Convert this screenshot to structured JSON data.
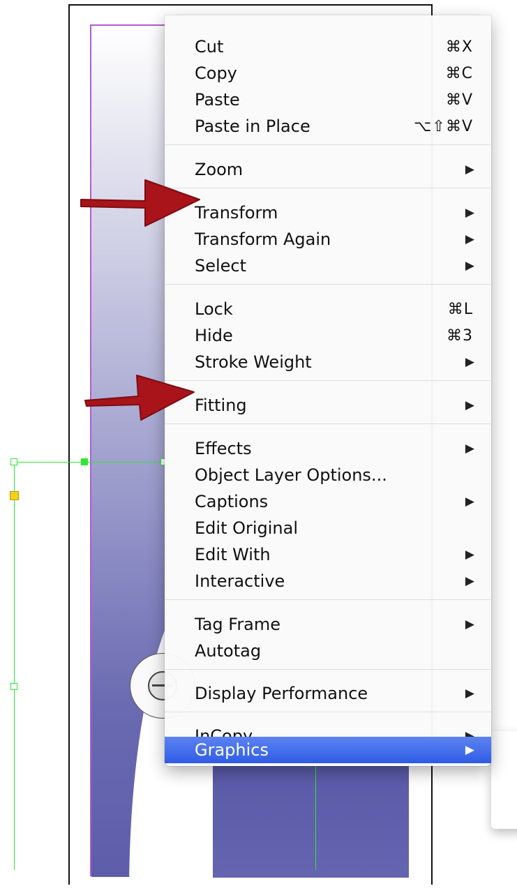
{
  "menu": {
    "items": [
      {
        "label": "Cut",
        "shortcut": "⌘X",
        "submenu": false
      },
      {
        "label": "Copy",
        "shortcut": "⌘C",
        "submenu": false
      },
      {
        "label": "Paste",
        "shortcut": "⌘V",
        "submenu": false
      },
      {
        "label": "Paste in Place",
        "shortcut": "⌥⇧⌘V",
        "submenu": false
      },
      {
        "label": "Zoom",
        "shortcut": "",
        "submenu": true
      },
      {
        "label": "Transform",
        "shortcut": "",
        "submenu": true
      },
      {
        "label": "Transform Again",
        "shortcut": "",
        "submenu": true
      },
      {
        "label": "Select",
        "shortcut": "",
        "submenu": true
      },
      {
        "label": "Lock",
        "shortcut": "⌘L",
        "submenu": false
      },
      {
        "label": "Hide",
        "shortcut": "⌘3",
        "submenu": false
      },
      {
        "label": "Stroke Weight",
        "shortcut": "",
        "submenu": true
      },
      {
        "label": "Fitting",
        "shortcut": "",
        "submenu": true
      },
      {
        "label": "Effects",
        "shortcut": "",
        "submenu": true
      },
      {
        "label": "Object Layer Options...",
        "shortcut": "",
        "submenu": false
      },
      {
        "label": "Captions",
        "shortcut": "",
        "submenu": true
      },
      {
        "label": "Edit Original",
        "shortcut": "",
        "submenu": false
      },
      {
        "label": "Edit With",
        "shortcut": "",
        "submenu": true
      },
      {
        "label": "Interactive",
        "shortcut": "",
        "submenu": true
      },
      {
        "label": "Tag Frame",
        "shortcut": "",
        "submenu": true
      },
      {
        "label": "Autotag",
        "shortcut": "",
        "submenu": false
      },
      {
        "label": "Display Performance",
        "shortcut": "",
        "submenu": true
      },
      {
        "label": "InCopy",
        "shortcut": "",
        "submenu": true
      },
      {
        "label": "Graphics",
        "shortcut": "",
        "submenu": true,
        "highlighted": true
      }
    ],
    "submenu_arrow": "▶"
  },
  "annotations": {
    "arrow_color": "#a8141a",
    "pointed_items": [
      "Transform",
      "Fitting"
    ]
  },
  "colors": {
    "highlight": "#3a65ea",
    "selection_frame": "#2ee82e",
    "margin_guide": "#b35bd6"
  }
}
